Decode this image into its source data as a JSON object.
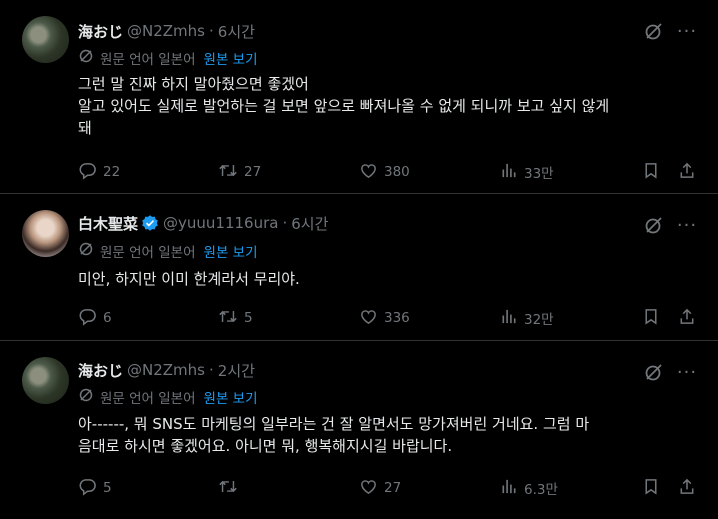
{
  "tweets": [
    {
      "name": "海おじ",
      "handle": "@N2Zmhs",
      "separator": "·",
      "time": "6시간",
      "verified": false,
      "translate_label": "원문 언어 일본어",
      "translate_action": "원본 보기",
      "lines": [
        "그런 말 진짜 하지 말아줬으면 좋겠어",
        "알고 있어도 실제로 발언하는 걸 보면 앞으로 빠져나올 수 없게 되니까 보고 싶지 않게",
        "돼"
      ],
      "stats": {
        "replies": "22",
        "retweets": "27",
        "likes": "380",
        "views": "33만"
      }
    },
    {
      "name": "白木聖菜",
      "handle": "@yuuu1116ura",
      "separator": "·",
      "time": "6시간",
      "verified": true,
      "translate_label": "원문 언어 일본어",
      "translate_action": "원본 보기",
      "lines": [
        "미안, 하지만 이미 한계라서 무리야."
      ],
      "stats": {
        "replies": "6",
        "retweets": "5",
        "likes": "336",
        "views": "32만"
      }
    },
    {
      "name": "海おじ",
      "handle": "@N2Zmhs",
      "separator": "·",
      "time": "2시간",
      "verified": false,
      "translate_label": "원문 언어 일본어",
      "translate_action": "원본 보기",
      "lines": [
        "아------, 뭐 SNS도 마케팅의 일부라는 건 잘 알면서도 망가져버린 거네요. 그럼 마",
        "음대로 하시면 좋겠어요. 아니면 뭐, 행복해지시길 바랍니다."
      ],
      "stats": {
        "replies": "5",
        "retweets": "",
        "likes": "27",
        "views": "6.3만"
      }
    }
  ],
  "more_glyph": "···",
  "colors": {
    "background": "#000000",
    "text": "#e7e9ea",
    "muted": "#71767b",
    "link": "#1d9bf0",
    "divider": "#2f3336"
  },
  "icons": [
    "grok-icon",
    "more-icon",
    "translate-icon",
    "reply-icon",
    "retweet-icon",
    "like-icon",
    "views-icon",
    "bookmark-icon",
    "share-icon",
    "verified-icon"
  ]
}
